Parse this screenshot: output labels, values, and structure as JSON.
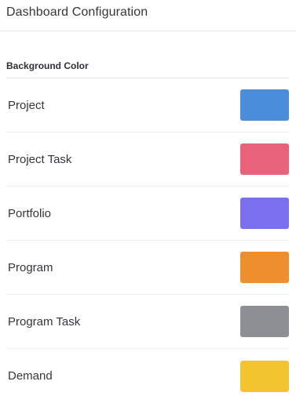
{
  "header": {
    "title": "Dashboard Configuration"
  },
  "background_color": {
    "section_title": "Background Color",
    "items": [
      {
        "label": "Project",
        "color": "#4a8ddb"
      },
      {
        "label": "Project Task",
        "color": "#e8627a"
      },
      {
        "label": "Portfolio",
        "color": "#7a70ee"
      },
      {
        "label": "Program",
        "color": "#ee8f2e"
      },
      {
        "label": "Program Task",
        "color": "#8e8f94"
      },
      {
        "label": "Demand",
        "color": "#f2c530"
      }
    ]
  }
}
